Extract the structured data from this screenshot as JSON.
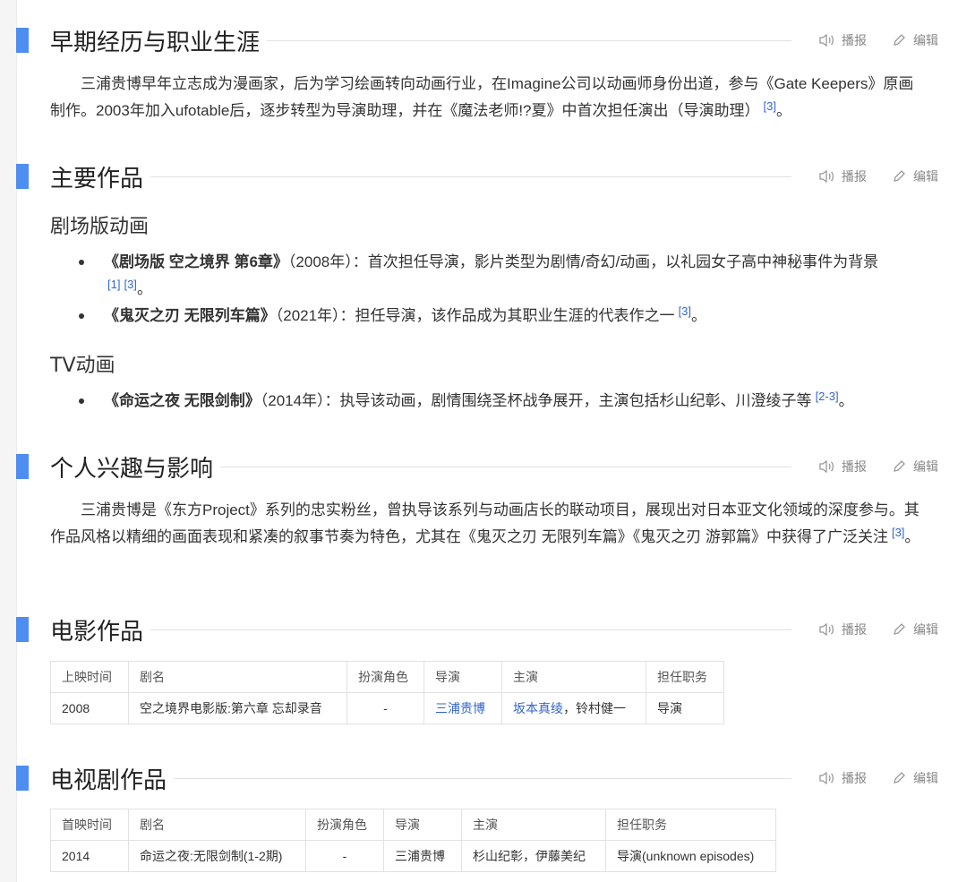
{
  "actions": {
    "broadcast": "播报",
    "edit": "编辑"
  },
  "sec_early": {
    "title": "早期经历与职业生涯",
    "para": "三浦贵博早年立志成为漫画家，后为学习绘画转向动画行业，在Imagine公司以动画师身份出道，参与《Gate Keepers》原画制作。2003年加入ufotable后，逐步转型为导演助理，并在《魔法老师!?夏》中首次担任演出（导演助理）",
    "ref": "[3]",
    "end": "。"
  },
  "sec_works": {
    "title": "主要作品",
    "theater_title": "剧场版动画",
    "theater_items": [
      {
        "name": "《剧场版 空之境界 第6章》",
        "desc": "（2008年）：首次担任导演，影片类型为剧情/奇幻/动画，以礼园女子高中神秘事件为背景",
        "ref1": "[1]",
        "ref2": "[3]",
        "end": "。"
      },
      {
        "name": "《鬼灭之刃 无限列车篇》",
        "desc": "（2021年）：担任导演，该作品成为其职业生涯的代表作之一",
        "ref1": "[3]",
        "end": "。"
      }
    ],
    "tv_title": "TV动画",
    "tv_items": [
      {
        "name": "《命运之夜 无限剑制》",
        "desc": "（2014年）：执导该动画，剧情围绕圣杯战争展开，主演包括杉山纪彰、川澄绫子等",
        "ref1": "[2-3]",
        "end": "。"
      }
    ]
  },
  "sec_interest": {
    "title": "个人兴趣与影响",
    "para": "三浦贵博是《东方Project》系列的忠实粉丝，曾执导该系列与动画店长的联动项目，展现出对日本亚文化领域的深度参与。其作品风格以精细的画面表现和紧凑的叙事节奏为特色，尤其在《鬼灭之刃 无限列车篇》《鬼灭之刃 游郭篇》中获得了广泛关注",
    "ref": "[3]",
    "end": "。"
  },
  "sec_film": {
    "title": "电影作品",
    "headers": [
      "上映时间",
      "剧名",
      "扮演角色",
      "导演",
      "主演",
      "担任职务"
    ],
    "row": {
      "year": "2008",
      "name": "空之境界电影版:第六章 忘却录音",
      "role": "-",
      "director": "三浦贵博",
      "cast_link": "坂本真绫",
      "cast_rest": "，铃村健一",
      "job": "导演"
    }
  },
  "sec_tv": {
    "title": "电视剧作品",
    "headers": [
      "首映时间",
      "剧名",
      "扮演角色",
      "导演",
      "主演",
      "担任职务"
    ],
    "row": {
      "year": "2014",
      "name": "命运之夜:无限剑制(1-2期)",
      "role": "-",
      "director": "三浦贵博",
      "cast": "杉山纪彰，伊藤美纪",
      "job": "导演(unknown episodes)"
    }
  },
  "colors": {
    "accent_bar": "#4e8ef0",
    "link": "#3366cc",
    "muted": "#888888"
  }
}
